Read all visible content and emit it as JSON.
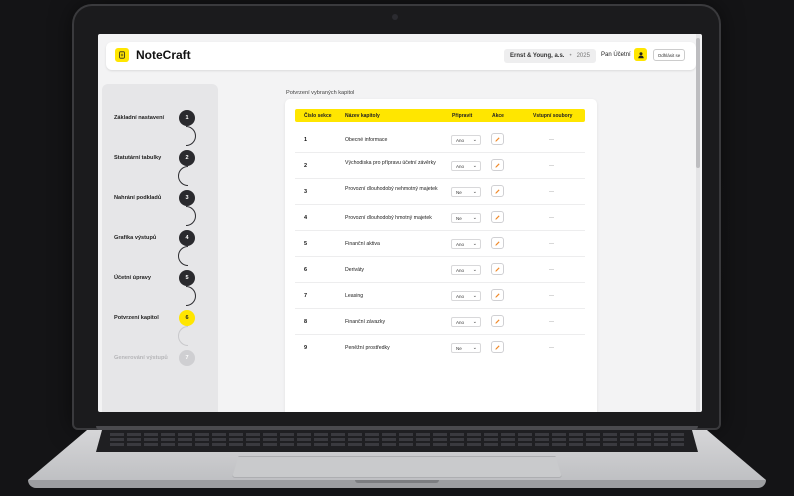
{
  "app": {
    "name": "NoteCraft"
  },
  "header": {
    "company": "Ernst & Young, a.s.",
    "separator": "•",
    "year": "2025",
    "user_name": "Pan Účetní",
    "logout_label": "Odhlásit se"
  },
  "sidebar": {
    "steps": [
      {
        "label": "Základní nastavení",
        "number": "1"
      },
      {
        "label": "Statutární tabulky",
        "number": "2"
      },
      {
        "label": "Nahrání podkladů",
        "number": "3"
      },
      {
        "label": "Grafika výstupů",
        "number": "4"
      },
      {
        "label": "Účetní úpravy",
        "number": "5"
      },
      {
        "label": "Potvrzení kapitol",
        "number": "6"
      },
      {
        "label": "Generování výstupů",
        "number": "7"
      }
    ]
  },
  "main": {
    "section_title": "Potvrzení vybraných kapitol",
    "columns": [
      "Číslo sekce",
      "Název kapitoly",
      "Připravit",
      "Akce",
      "Vstupní soubory"
    ],
    "rows": [
      {
        "num": "1",
        "name": "Obecné informace",
        "prepare": "Ano",
        "files": "—"
      },
      {
        "num": "2",
        "name": "Východiska pro přípravu účetní závěrky",
        "prepare": "Ano",
        "files": "—"
      },
      {
        "num": "3",
        "name": "Provozní dlouhodobý nehmotný majetek",
        "prepare": "Ne",
        "files": "—"
      },
      {
        "num": "4",
        "name": "Provozní dlouhodobý hmotný majetek",
        "prepare": "Ne",
        "files": "—"
      },
      {
        "num": "5",
        "name": "Finanční aktiva",
        "prepare": "Ano",
        "files": "—"
      },
      {
        "num": "6",
        "name": "Deriváty",
        "prepare": "Ano",
        "files": "—"
      },
      {
        "num": "7",
        "name": "Leasing",
        "prepare": "Ano",
        "files": "—"
      },
      {
        "num": "8",
        "name": "Finanční závazky",
        "prepare": "Ano",
        "files": "—"
      },
      {
        "num": "9",
        "name": "Peněžní prostředky",
        "prepare": "Ne",
        "files": "—"
      }
    ]
  },
  "colors": {
    "accent": "#ffe600",
    "dark": "#2a2a2e"
  },
  "icons": {
    "logo": "notebook-icon",
    "user": "user-icon",
    "edit": "pencil-icon",
    "dropdown": "chevron-down-icon"
  }
}
